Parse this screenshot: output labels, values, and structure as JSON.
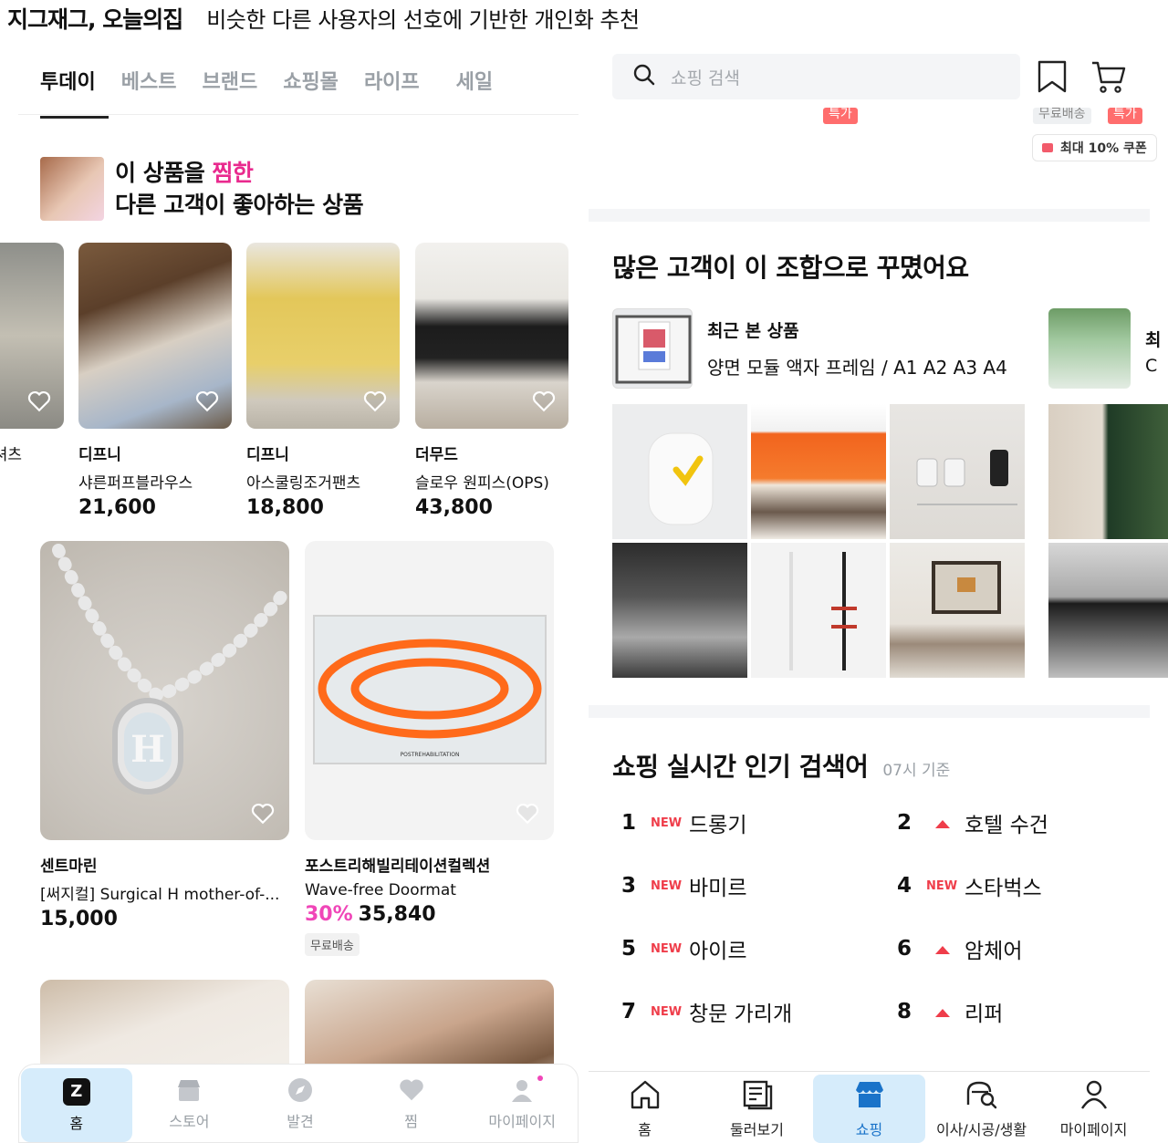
{
  "header": {
    "app_name": "지그재그, 오늘의집",
    "description": "비슷한 다른 사용자의 선호에 기반한 개인화 추천"
  },
  "left": {
    "tabs": [
      {
        "label": "투데이",
        "active": true
      },
      {
        "label": "베스트",
        "active": false
      },
      {
        "label": "브랜드",
        "active": false
      },
      {
        "label": "쇼핑몰",
        "active": false
      },
      {
        "label": "라이프",
        "active": false
      },
      {
        "label": "세일",
        "active": false
      }
    ],
    "rec_header": {
      "line1_prefix": "이 상품을 ",
      "line1_highlight": "찜한",
      "line2": "다른 고객이 좋아하는 상품"
    },
    "small_products": [
      {
        "brand": "",
        "name": "셔츠",
        "price": ""
      },
      {
        "brand": "디프니",
        "name": "샤른퍼프블라우스",
        "price": "21,600"
      },
      {
        "brand": "디프니",
        "name": "아스쿨링조거팬츠",
        "price": "18,800"
      },
      {
        "brand": "더무드",
        "name": "슬로우 원피스(OPS)",
        "price": "43,800"
      }
    ],
    "big_products": [
      {
        "brand": "센트마린",
        "name": "[써지컬] Surgical H mother-of-...",
        "discount": "",
        "price": "15,000",
        "badge": ""
      },
      {
        "brand": "포스트리해빌리테이션컬렉션",
        "name": "Wave-free Doormat",
        "discount": "30%",
        "price": "35,840",
        "badge": "무료배송"
      }
    ],
    "doormat_brand_text": "POSTREHABILITATION",
    "nav": [
      {
        "label": "홈",
        "icon": "z-logo-icon",
        "active": true
      },
      {
        "label": "스토어",
        "icon": "store-icon",
        "active": false
      },
      {
        "label": "발견",
        "icon": "compass-icon",
        "active": false
      },
      {
        "label": "찜",
        "icon": "heart-icon",
        "active": false
      },
      {
        "label": "마이페이지",
        "icon": "person-icon",
        "active": false
      }
    ],
    "nav_logo_letter": "Z"
  },
  "right": {
    "search_placeholder": "쇼핑 검색",
    "tag_left": "특가",
    "tag_free": "무료배송",
    "tag_right": "특가",
    "coupon": "최대 10% 쿠폰",
    "combo_title": "많은 고객이 이 조합으로 꾸몄어요",
    "recent_label": "최근 본 상품",
    "recent_name": "양면 모듈 액자 프레임 / A1 A2 A3 A4",
    "recent2_label": "최",
    "recent2_name": "C",
    "popular_title": "쇼핑 실시간 인기 검색어",
    "popular_time": "07시 기준",
    "ranks": [
      {
        "rank": "1",
        "status": "NEW",
        "keyword": "드롱기"
      },
      {
        "rank": "2",
        "status": "up",
        "keyword": "호텔 수건"
      },
      {
        "rank": "3",
        "status": "NEW",
        "keyword": "바미르"
      },
      {
        "rank": "4",
        "status": "NEW",
        "keyword": "스타벅스"
      },
      {
        "rank": "5",
        "status": "NEW",
        "keyword": "아이르"
      },
      {
        "rank": "6",
        "status": "up",
        "keyword": "암체어"
      },
      {
        "rank": "7",
        "status": "NEW",
        "keyword": "창문 가리개"
      },
      {
        "rank": "8",
        "status": "up",
        "keyword": "리퍼"
      }
    ],
    "nav": [
      {
        "label": "홈",
        "icon": "house-icon",
        "active": false
      },
      {
        "label": "둘러보기",
        "icon": "browse-icon",
        "active": false
      },
      {
        "label": "쇼핑",
        "icon": "shop-icon",
        "active": true
      },
      {
        "label": "이사/시공/생활",
        "icon": "moving-search-icon",
        "active": false
      },
      {
        "label": "마이페이지",
        "icon": "person-icon",
        "active": false
      }
    ]
  },
  "colors": {
    "accent_pink": "#e92a8e",
    "discount_pink": "#f046b8",
    "new_red": "#ef3d4a",
    "active_nav_bg": "#d6ecfb",
    "active_nav_text": "#1a73c9"
  }
}
